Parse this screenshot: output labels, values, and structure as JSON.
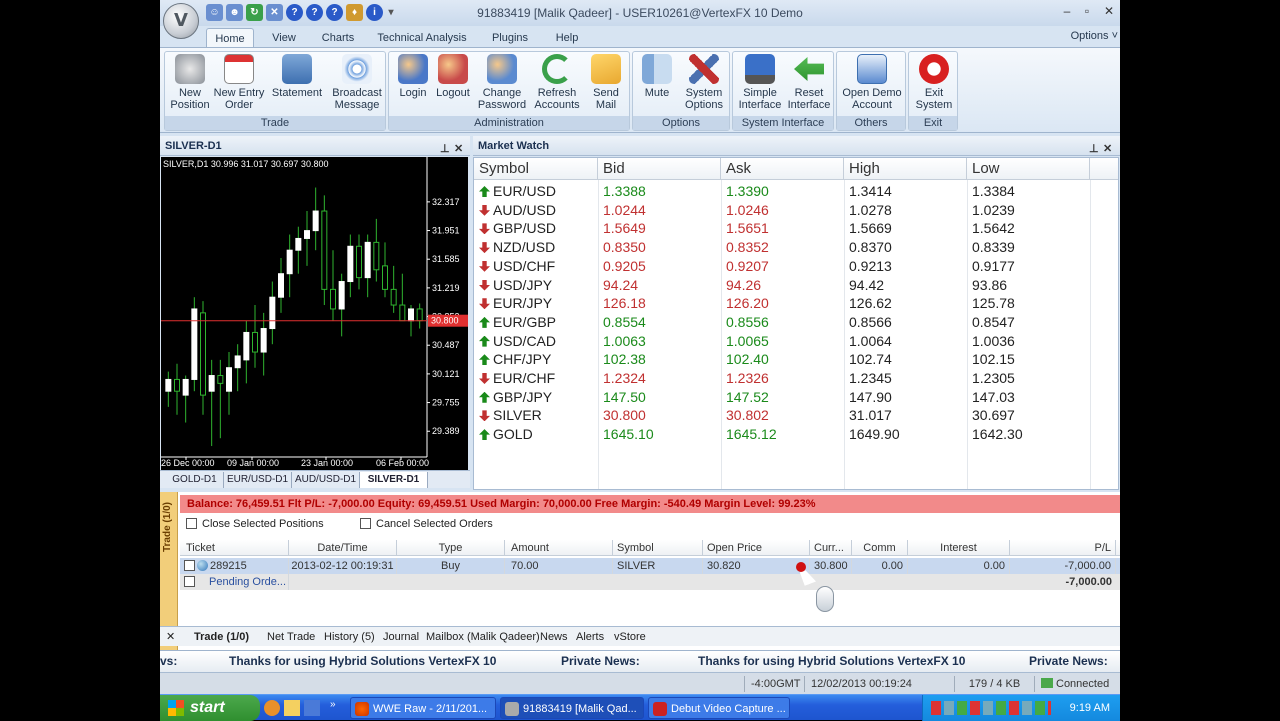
{
  "window": {
    "title": "91883419 [Malik Qadeer] - USER10261@VertexFX 10 Demo",
    "orb_glyph": "V"
  },
  "menu_tabs": [
    "Home",
    "View",
    "Charts",
    "Technical Analysis",
    "Plugins",
    "Help"
  ],
  "options_label": "Options ˅",
  "ribbon": {
    "groups": [
      {
        "label": "Trade",
        "buttons": [
          [
            "New",
            "Position"
          ],
          [
            "New Entry",
            "Order"
          ],
          [
            "Statement",
            ""
          ],
          [
            "Broadcast",
            "Message"
          ]
        ]
      },
      {
        "label": "Administration",
        "buttons": [
          [
            "Login",
            ""
          ],
          [
            "Logout",
            ""
          ],
          [
            "Change",
            "Password"
          ],
          [
            "Refresh",
            "Accounts"
          ],
          [
            "Send",
            "Mail"
          ]
        ]
      },
      {
        "label": "Options",
        "buttons": [
          [
            "Mute",
            ""
          ],
          [
            "System",
            "Options"
          ]
        ]
      },
      {
        "label": "System Interface",
        "buttons": [
          [
            "Simple",
            "Interface"
          ],
          [
            "Reset",
            "Interface"
          ]
        ]
      },
      {
        "label": "Others",
        "buttons": [
          [
            "Open Demo",
            "Account"
          ]
        ]
      },
      {
        "label": "Exit",
        "buttons": [
          [
            "Exit",
            "System"
          ]
        ]
      }
    ]
  },
  "chart_panel": {
    "title": "SILVER-D1",
    "header_info": "SILVER,D1  30.996  31.017  30.697  30.800",
    "current_price_label": "30.800",
    "tabs": [
      "GOLD-D1",
      "EUR/USD-D1",
      "AUD/USD-D1",
      "SILVER-D1"
    ],
    "active_tab": "SILVER-D1"
  },
  "chart_data": {
    "type": "candlestick",
    "symbol": "SILVER",
    "timeframe": "D1",
    "y_ticks": [
      32.317,
      31.951,
      31.585,
      31.219,
      30.853,
      30.487,
      30.121,
      29.755,
      29.389
    ],
    "x_ticks": [
      "26 Dec 00:00",
      "09 Jan 00:00",
      "23 Jan 00:00",
      "06 Feb 00:00"
    ],
    "ylim": [
      29.06,
      32.66
    ],
    "current_price": 30.8,
    "candles": [
      [
        29.9,
        30.15,
        29.7,
        30.05
      ],
      [
        30.05,
        30.25,
        29.6,
        29.9
      ],
      [
        29.85,
        30.1,
        29.5,
        30.05
      ],
      [
        30.05,
        31.1,
        29.9,
        30.95
      ],
      [
        30.9,
        31.05,
        29.6,
        29.85
      ],
      [
        29.9,
        30.3,
        29.2,
        30.1
      ],
      [
        30.1,
        30.3,
        29.3,
        30.0
      ],
      [
        29.9,
        30.4,
        29.6,
        30.2
      ],
      [
        30.2,
        30.5,
        29.9,
        30.35
      ],
      [
        30.3,
        30.8,
        30.0,
        30.65
      ],
      [
        30.65,
        31.0,
        30.2,
        30.4
      ],
      [
        30.4,
        30.9,
        30.1,
        30.7
      ],
      [
        30.7,
        31.3,
        30.5,
        31.1
      ],
      [
        31.1,
        31.6,
        30.9,
        31.4
      ],
      [
        31.4,
        31.9,
        31.1,
        31.7
      ],
      [
        31.7,
        32.0,
        31.4,
        31.85
      ],
      [
        31.85,
        32.2,
        31.5,
        31.95
      ],
      [
        31.95,
        32.5,
        31.7,
        32.2
      ],
      [
        32.2,
        32.4,
        31.0,
        31.2
      ],
      [
        31.2,
        31.7,
        30.8,
        30.95
      ],
      [
        30.95,
        31.4,
        30.6,
        31.3
      ],
      [
        31.3,
        31.9,
        31.1,
        31.75
      ],
      [
        31.75,
        31.9,
        31.2,
        31.35
      ],
      [
        31.35,
        31.9,
        31.1,
        31.8
      ],
      [
        31.8,
        32.1,
        31.3,
        31.45
      ],
      [
        31.5,
        31.8,
        31.1,
        31.2
      ],
      [
        31.2,
        31.5,
        30.9,
        31.0
      ],
      [
        31.0,
        31.4,
        30.8,
        30.8
      ],
      [
        30.8,
        31.0,
        30.6,
        30.95
      ],
      [
        30.95,
        31.02,
        30.7,
        30.8
      ]
    ]
  },
  "market_watch": {
    "title": "Market Watch",
    "columns": [
      "Symbol",
      "Bid",
      "Ask",
      "High",
      "Low"
    ],
    "rows": [
      {
        "symbol": "EUR/USD",
        "dir": "up",
        "bid": "1.3388",
        "ask": "1.3390",
        "high": "1.3414",
        "low": "1.3384"
      },
      {
        "symbol": "AUD/USD",
        "dir": "down",
        "bid": "1.0244",
        "ask": "1.0246",
        "high": "1.0278",
        "low": "1.0239"
      },
      {
        "symbol": "GBP/USD",
        "dir": "down",
        "bid": "1.5649",
        "ask": "1.5651",
        "high": "1.5669",
        "low": "1.5642"
      },
      {
        "symbol": "NZD/USD",
        "dir": "down",
        "bid": "0.8350",
        "ask": "0.8352",
        "high": "0.8370",
        "low": "0.8339"
      },
      {
        "symbol": "USD/CHF",
        "dir": "down",
        "bid": "0.9205",
        "ask": "0.9207",
        "high": "0.9213",
        "low": "0.9177"
      },
      {
        "symbol": "USD/JPY",
        "dir": "down",
        "bid": "94.24",
        "ask": "94.26",
        "high": "94.42",
        "low": "93.86"
      },
      {
        "symbol": "EUR/JPY",
        "dir": "down",
        "bid": "126.18",
        "ask": "126.20",
        "high": "126.62",
        "low": "125.78"
      },
      {
        "symbol": "EUR/GBP",
        "dir": "up",
        "bid": "0.8554",
        "ask": "0.8556",
        "high": "0.8566",
        "low": "0.8547"
      },
      {
        "symbol": "USD/CAD",
        "dir": "up",
        "bid": "1.0063",
        "ask": "1.0065",
        "high": "1.0064",
        "low": "1.0036"
      },
      {
        "symbol": "CHF/JPY",
        "dir": "up",
        "bid": "102.38",
        "ask": "102.40",
        "high": "102.74",
        "low": "102.15"
      },
      {
        "symbol": "EUR/CHF",
        "dir": "down",
        "bid": "1.2324",
        "ask": "1.2326",
        "high": "1.2345",
        "low": "1.2305"
      },
      {
        "symbol": "GBP/JPY",
        "dir": "up",
        "bid": "147.50",
        "ask": "147.52",
        "high": "147.90",
        "low": "147.03"
      },
      {
        "symbol": "SILVER",
        "dir": "down",
        "bid": "30.800",
        "ask": "30.802",
        "high": "31.017",
        "low": "30.697"
      },
      {
        "symbol": "GOLD",
        "dir": "up",
        "bid": "1645.10",
        "ask": "1645.12",
        "high": "1649.90",
        "low": "1642.30"
      }
    ]
  },
  "terminal": {
    "side_label": "Trade (1/0)",
    "balance_line": "Balance: 76,459.51  Flt P/L: -7,000.00  Equity: 69,459.51  Used Margin: 70,000.00  Free Margin: -540.49  Margin Level: 99.23%",
    "close_selected": "Close Selected Positions",
    "cancel_selected": "Cancel Selected Orders",
    "columns": [
      "Ticket",
      "Date/Time",
      "Type",
      "Amount",
      "Symbol",
      "Open Price",
      "Curr...",
      "Comm",
      "Interest",
      "P/L"
    ],
    "position": {
      "ticket": "289215",
      "datetime": "2013-02-12 00:19:31",
      "type": "Buy",
      "amount": "70.00",
      "symbol": "SILVER",
      "open_price": "30.820",
      "current": "30.800",
      "comm": "0.00",
      "interest": "0.00",
      "pl": "-7,000.00"
    },
    "pending": {
      "label": "Pending Orde...",
      "total": "-7,000.00"
    },
    "tabs": [
      "Trade (1/0)",
      "Net Trade",
      "History (5)",
      "Journal",
      "Mailbox (Malik Qadeer)",
      "News",
      "Alerts",
      "vStore"
    ]
  },
  "ticker": [
    "vs:",
    "Thanks for using Hybrid Solutions VertexFX 10",
    "Private News:",
    "Thanks for using Hybrid Solutions VertexFX 10",
    "Private News:"
  ],
  "status": {
    "tz": "-4:00GMT",
    "datetime": "12/02/2013 00:19:24",
    "traffic": "179 / 4 KB",
    "connection": "Connected"
  },
  "taskbar": {
    "start": "start",
    "tasks": [
      "WWE Raw - 2/11/201...",
      "91883419 [Malik Qad...",
      "Debut Video Capture ..."
    ],
    "clock": "9:19 AM"
  },
  "colors": {
    "up": "#1a8a1a",
    "down": "#c03030",
    "balance_bg": "#f28a8a"
  }
}
